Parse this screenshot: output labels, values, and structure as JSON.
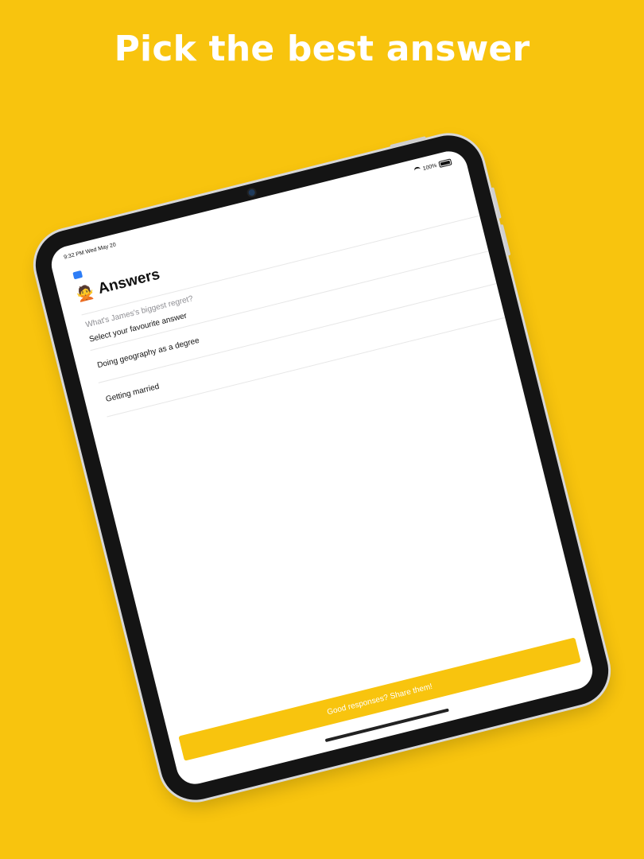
{
  "headline": "Pick the best answer",
  "status_bar": {
    "time": "9:32 PM",
    "date": "Wed May 20",
    "battery": "100%"
  },
  "screen": {
    "title_emoji": "🙅",
    "title": "Answers",
    "question": "What's James's biggest regret?",
    "section_label": "Select your favourite answer",
    "answers": [
      "Doing geography as a degree",
      "Getting married"
    ],
    "share_button": "Good responses? Share them!"
  },
  "colors": {
    "background": "#F8C40E",
    "button": "#F8C40E",
    "bezel": "#141414",
    "screen": "#FFFFFF"
  }
}
